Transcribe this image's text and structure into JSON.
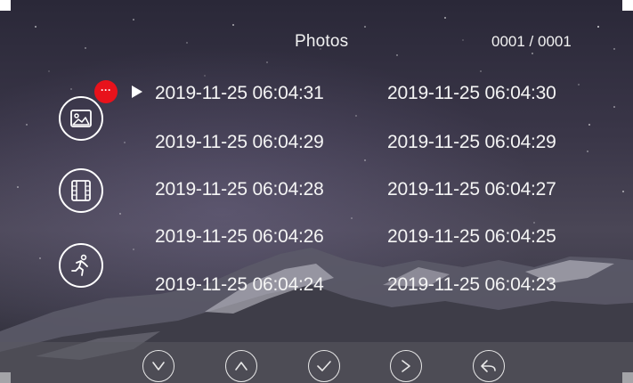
{
  "header": {
    "title": "Photos",
    "counter": "0001 / 0001"
  },
  "sidebar": {
    "items": [
      {
        "icon": "image-icon",
        "badge": "···",
        "badge_color": "#e8121b"
      },
      {
        "icon": "film-icon"
      },
      {
        "icon": "running-person-icon"
      }
    ]
  },
  "list": {
    "selected_index": 0,
    "entries": [
      "2019-11-25 06:04:31",
      "2019-11-25 06:04:30",
      "2019-11-25 06:04:29",
      "2019-11-25 06:04:29",
      "2019-11-25 06:04:28",
      "2019-11-25 06:04:27",
      "2019-11-25 06:04:26",
      "2019-11-25 06:04:25",
      "2019-11-25 06:04:24",
      "2019-11-25 06:04:23"
    ]
  },
  "toolbar": {
    "buttons": [
      {
        "icon": "chevron-down-icon"
      },
      {
        "icon": "chevron-up-icon"
      },
      {
        "icon": "check-icon"
      },
      {
        "icon": "chevron-right-icon"
      },
      {
        "icon": "back-arrow-icon"
      }
    ]
  }
}
